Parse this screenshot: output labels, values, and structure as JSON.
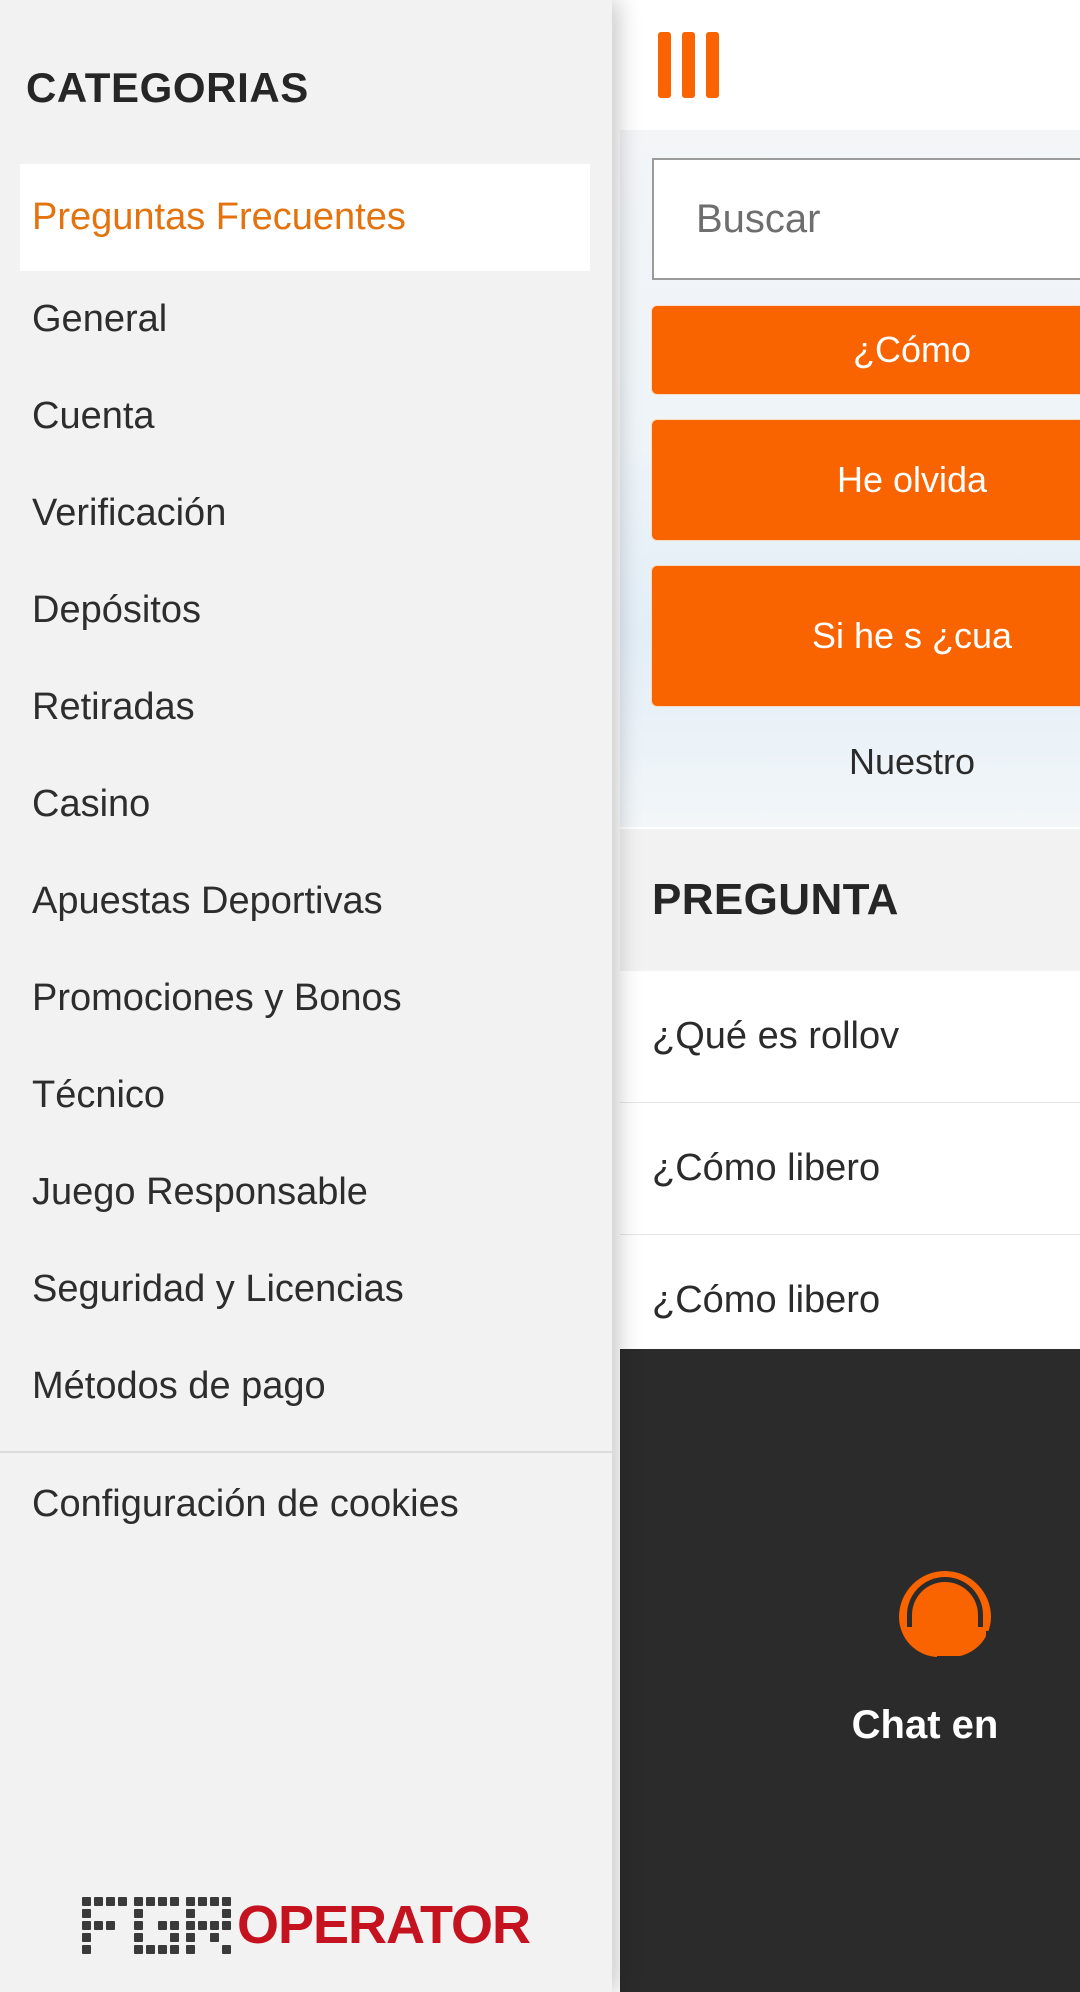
{
  "brand": {
    "accent_orange": "#f96300",
    "accent_orange_text": "#e3730f",
    "logo_mark": "FGR",
    "logo_word": "OPERATOR",
    "logo_word_color": "#c4121f"
  },
  "drawer": {
    "title": "CATEGORIAS",
    "items": [
      {
        "label": "Preguntas Frecuentes",
        "active": true
      },
      {
        "label": "General",
        "active": false
      },
      {
        "label": "Cuenta",
        "active": false
      },
      {
        "label": "Verificación",
        "active": false
      },
      {
        "label": "Depósitos",
        "active": false
      },
      {
        "label": "Retiradas",
        "active": false
      },
      {
        "label": "Casino",
        "active": false
      },
      {
        "label": "Apuestas Deportivas",
        "active": false
      },
      {
        "label": "Promociones y Bonos",
        "active": false
      },
      {
        "label": "Técnico",
        "active": false
      },
      {
        "label": "Juego Responsable",
        "active": false
      },
      {
        "label": "Seguridad y Licencias",
        "active": false
      },
      {
        "label": "Métodos de pago",
        "active": false
      }
    ],
    "cookies_label": "Configuración de cookies"
  },
  "main": {
    "menu_icon": "hamburger-icon",
    "search": {
      "placeholder": "Buscar",
      "value": ""
    },
    "quick_links": [
      "¿Cómo",
      "He olvida",
      "Si he s ¿cua"
    ],
    "hero_note": "Nuestro ",
    "section_title": "PREGUNTA",
    "faq_items": [
      "¿Qué es rollov",
      "¿Cómo libero",
      "¿Cómo libero"
    ]
  },
  "chat": {
    "icon": "headset-icon",
    "label": "Chat en"
  }
}
